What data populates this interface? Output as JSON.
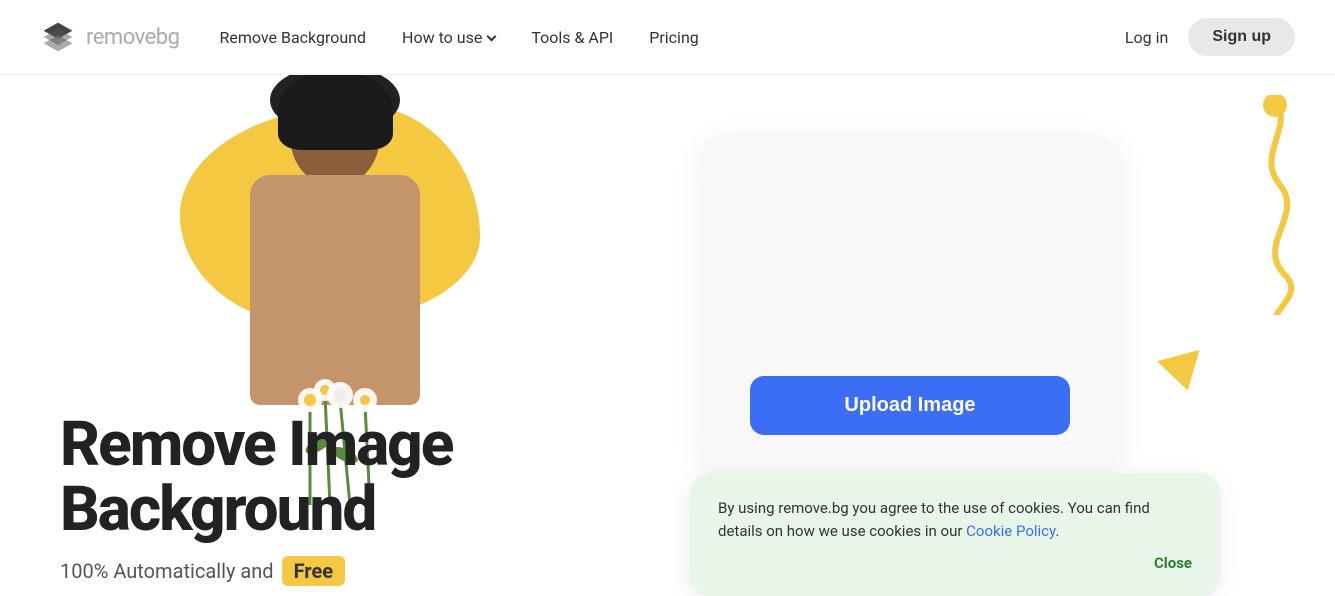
{
  "brand": {
    "logo_text_main": "remove",
    "logo_text_accent": "bg",
    "logo_alt": "remove.bg logo"
  },
  "nav": {
    "links": [
      {
        "id": "remove-background",
        "label": "Remove Background",
        "has_dropdown": false
      },
      {
        "id": "how-to-use",
        "label": "How to use",
        "has_dropdown": true
      },
      {
        "id": "tools-api",
        "label": "Tools & API",
        "has_dropdown": false
      },
      {
        "id": "pricing",
        "label": "Pricing",
        "has_dropdown": false
      }
    ],
    "login_label": "Log in",
    "signup_label": "Sign up"
  },
  "hero": {
    "headline_line1": "Remove Image",
    "headline_line2": "Background",
    "subtitle_text": "100% Automatically and",
    "free_badge": "Free"
  },
  "upload": {
    "button_label": "Upload Image"
  },
  "cookie": {
    "text": "By using remove.bg you agree to the use of cookies. You can find details on how we use cookies in our",
    "link_text": "Cookie Policy",
    "link_suffix": ".",
    "close_label": "Close"
  }
}
